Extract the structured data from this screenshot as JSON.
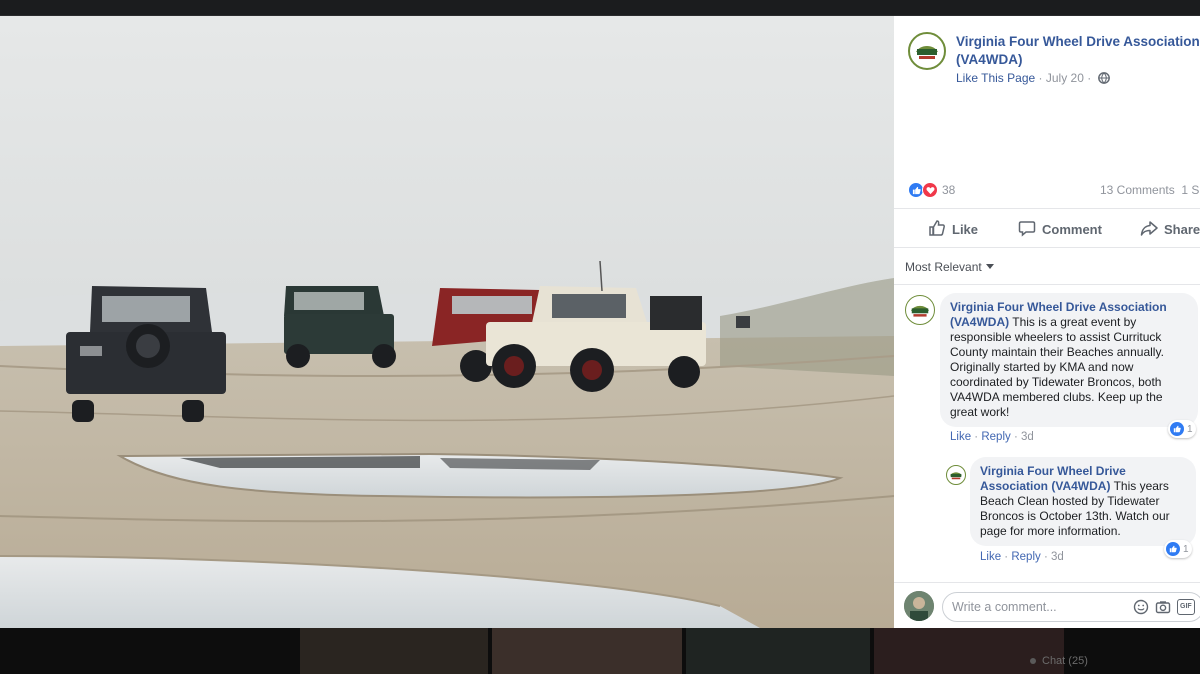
{
  "post": {
    "page_name": "Virginia Four Wheel Drive Association (VA4WDA)",
    "like_page": "Like This Page",
    "separator": "·",
    "date": "July 20",
    "reaction_count": "38",
    "comments": "13 Comments",
    "shares": "1 Sh",
    "actions": {
      "like": "Like",
      "comment": "Comment",
      "share": "Share"
    }
  },
  "comments_filter": "Most Relevant",
  "comments": [
    {
      "author": "Virginia Four Wheel Drive Association (VA4WDA)",
      "text": "This is a great event by responsible wheelers to assist Currituck County maintain their Beaches annually. Originally started by KMA and now coordinated by Tidewater Broncos, both VA4WDA membered clubs. Keep up the great work!",
      "like": "Like",
      "reply": "Reply",
      "time": "3d",
      "reaction_count": "1"
    },
    {
      "author": "Virginia Four Wheel Drive Association (VA4WDA)",
      "text": "This years Beach Clean hosted by Tidewater Broncos is October 13th. Watch our page for more information.",
      "like": "Like",
      "reply": "Reply",
      "time": "3d",
      "reaction_count": "1"
    }
  ],
  "composer": {
    "placeholder": "Write a comment..."
  },
  "chat": {
    "label": "Chat (25)"
  },
  "icons": [
    "globe-icon",
    "like-reaction-icon",
    "love-reaction-icon",
    "thumbs-up-icon",
    "comment-bubble-icon",
    "share-arrow-icon",
    "caret-down-icon",
    "emoji-icon",
    "camera-icon",
    "gif-icon"
  ],
  "colors": {
    "link": "#365899",
    "like_blue": "#2f7bf3",
    "love_red": "#f0384a",
    "bubble_bg": "#f2f3f5",
    "muted": "#90949c"
  }
}
